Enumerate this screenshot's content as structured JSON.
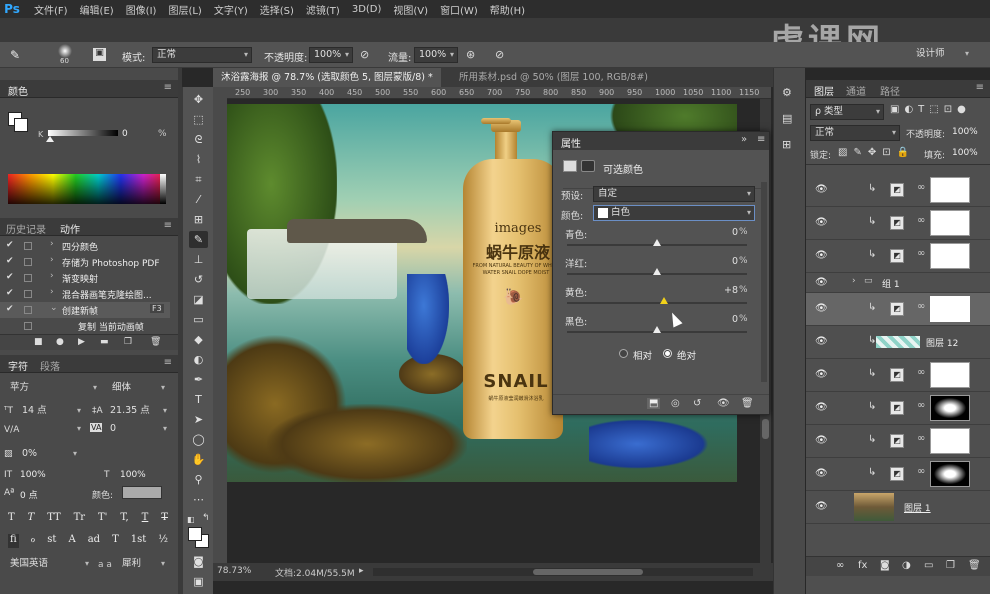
{
  "app": {
    "logo": "Ps"
  },
  "menu": [
    "文件(F)",
    "编辑(E)",
    "图像(I)",
    "图层(L)",
    "文字(Y)",
    "选择(S)",
    "滤镜(T)",
    "3D(D)",
    "视图(V)",
    "窗口(W)",
    "帮助(H)"
  ],
  "options": {
    "brush_size": "60",
    "mode_label": "模式:",
    "mode_value": "正常",
    "opacity_label": "不透明度:",
    "opacity_value": "100%",
    "flow_label": "流量:",
    "flow_value": "100%",
    "workspace": "设计师"
  },
  "watermark": "虎课网",
  "tabs": [
    {
      "label": "沐浴露海报 @ 78.7% (选取颜色 5, 图层蒙版/8) *",
      "active": true
    },
    {
      "label": "所用素材.psd @ 50% (图层 100, RGB/8#)",
      "active": false
    }
  ],
  "ruler": [
    "250",
    "300",
    "350",
    "400",
    "450",
    "500",
    "550",
    "600",
    "650",
    "700",
    "750",
    "800",
    "850",
    "900",
    "950",
    "1000",
    "1050",
    "1100",
    "1150"
  ],
  "color_panel": {
    "title": "颜色",
    "k_label": "K",
    "k_value": "0",
    "k_unit": "%"
  },
  "history_panel": {
    "tabs": [
      "历史记录",
      "动作"
    ],
    "items": [
      {
        "label": "四分颜色",
        "checked": true
      },
      {
        "label": "存储为 Photoshop PDF",
        "checked": true
      },
      {
        "label": "渐变映射",
        "checked": true
      },
      {
        "label": "混合器画笔克隆绘图...",
        "checked": true
      },
      {
        "label": "创建新帧",
        "checked": true,
        "shortcut": "F3",
        "selected": true
      },
      {
        "label": "复制 当前动画帧",
        "checked": false
      }
    ]
  },
  "char_panel": {
    "tabs": [
      "字符",
      "段落"
    ],
    "font_family": "苹方",
    "font_style": "细体",
    "font_size": "14 点",
    "leading": "21.35 点",
    "kerning_label": "V/A",
    "tracking_label": "VA",
    "tracking": "0",
    "scale_pct": "0%",
    "vscale": "100%",
    "hscale": "100%",
    "baseline": "0 点",
    "color_label": "颜色:",
    "styles": [
      "T",
      "T",
      "TT",
      "Tr",
      "T'",
      "T,",
      "T",
      "T"
    ],
    "opentype": [
      "fi",
      "ℴ",
      "st",
      "A",
      "ad",
      "T",
      "1st",
      "½"
    ],
    "language": "美国英语",
    "aa_label": "a a",
    "aa_value": "犀利"
  },
  "properties": {
    "title": "属性",
    "subtitle": "可选颜色",
    "preset_label": "预设:",
    "preset_value": "自定",
    "color_label": "颜色:",
    "color_value": "白色",
    "sliders": [
      {
        "name": "青色:",
        "value": "0",
        "fraction": 0.5
      },
      {
        "name": "洋红:",
        "value": "0",
        "fraction": 0.5
      },
      {
        "name": "黄色:",
        "value": "+8",
        "fraction": 0.54
      },
      {
        "name": "黑色:",
        "value": "0",
        "fraction": 0.5
      }
    ],
    "unit": "%",
    "radio_relative": "相对",
    "radio_absolute": "绝对",
    "radio_selected": "绝对"
  },
  "layers_panel": {
    "tabs": [
      "图层",
      "通道",
      "路径"
    ],
    "filter_label": "ρ 类型",
    "blend_mode": "正常",
    "opacity_label": "不透明度:",
    "opacity_value": "100%",
    "lock_label": "锁定:",
    "fill_label": "填充:",
    "fill_value": "100%",
    "rows": [
      {
        "type": "adj",
        "name": ""
      },
      {
        "type": "adj",
        "name": ""
      },
      {
        "type": "adj",
        "name": ""
      },
      {
        "type": "group",
        "name": "组 1"
      },
      {
        "type": "adj-selected",
        "name": ""
      },
      {
        "type": "pixel",
        "name": "图层 12"
      },
      {
        "type": "adj",
        "name": ""
      },
      {
        "type": "adj",
        "name": ""
      },
      {
        "type": "adj",
        "name": ""
      },
      {
        "type": "adj",
        "name": ""
      },
      {
        "type": "image",
        "name": "图层 1"
      }
    ],
    "footer_icons": [
      "link-icon",
      "fx-icon",
      "mask-icon",
      "adjustment-icon",
      "folder-icon",
      "new-layer-icon",
      "trash-icon"
    ]
  },
  "status": {
    "zoom": "78.73%",
    "doc": "文档:2.04M/55.5M"
  },
  "product": {
    "brand": "images",
    "title_cn": "蜗牛原液",
    "line1": "FROM NATURAL BEAUTY OF WHITE",
    "line2": "WATER SNAIL DOPE MOIST",
    "snail": "SNAIL",
    "small": "蜗牛原液莹润嫩滑沐浴乳"
  },
  "colors": {
    "ps_blue": "#31a8ff",
    "panel_bg": "#535353",
    "dark_bg": "#282828",
    "selected_row": "#666666"
  }
}
